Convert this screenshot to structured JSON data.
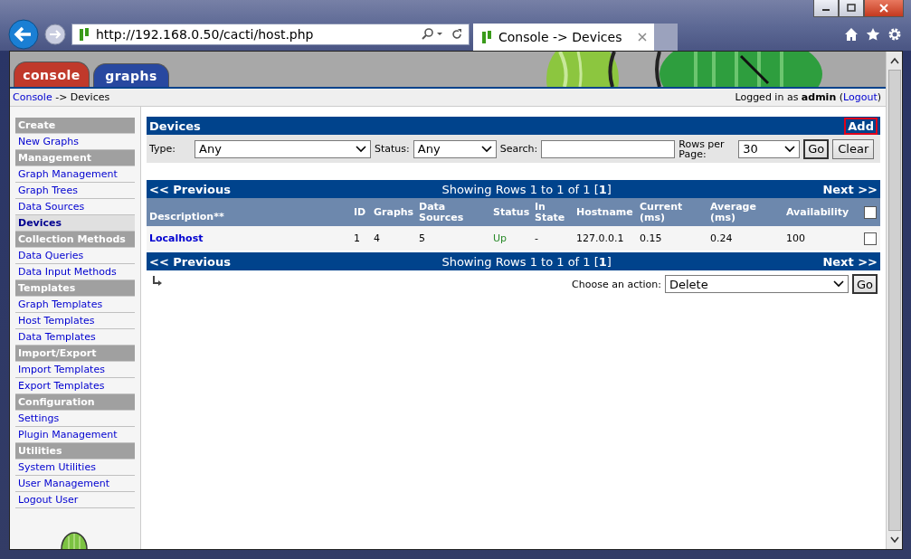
{
  "browser": {
    "address": "http://192.168.0.50/cacti/host.php",
    "tab_title": "Console -> Devices"
  },
  "header": {
    "tabs": [
      {
        "label": "console",
        "selected": true,
        "color": "#c0392b"
      },
      {
        "label": "graphs",
        "selected": false,
        "color": "#2848a0"
      }
    ],
    "breadcrumb_link": "Console",
    "breadcrumb_rest": "-> Devices",
    "login_text": "Logged in as **admin** (",
    "logout_link": "Logout",
    "login_close": ")"
  },
  "sidebar": [
    {
      "title": "Create",
      "items": [
        {
          "label": "New Graphs",
          "selected": false
        }
      ]
    },
    {
      "title": "Management",
      "items": [
        {
          "label": "Graph Management",
          "selected": false
        },
        {
          "label": "Graph Trees",
          "selected": false
        },
        {
          "label": "Data Sources",
          "selected": false
        },
        {
          "label": "Devices",
          "selected": true
        }
      ]
    },
    {
      "title": "Collection Methods",
      "items": [
        {
          "label": "Data Queries",
          "selected": false
        },
        {
          "label": "Data Input Methods",
          "selected": false
        }
      ]
    },
    {
      "title": "Templates",
      "items": [
        {
          "label": "Graph Templates",
          "selected": false
        },
        {
          "label": "Host Templates",
          "selected": false
        },
        {
          "label": "Data Templates",
          "selected": false
        }
      ]
    },
    {
      "title": "Import/Export",
      "items": [
        {
          "label": "Import Templates",
          "selected": false
        },
        {
          "label": "Export Templates",
          "selected": false
        }
      ]
    },
    {
      "title": "Configuration",
      "items": [
        {
          "label": "Settings",
          "selected": false
        },
        {
          "label": "Plugin Management",
          "selected": false
        }
      ]
    },
    {
      "title": "Utilities",
      "items": [
        {
          "label": "System Utilities",
          "selected": false
        },
        {
          "label": "User Management",
          "selected": false
        },
        {
          "label": "Logout User",
          "selected": false
        }
      ]
    }
  ],
  "panel": {
    "title": "Devices",
    "add": "Add",
    "filters": {
      "type_label": "Type:",
      "type_value": "Any",
      "status_label": "Status:",
      "status_value": "Any",
      "search_label": "Search:",
      "rows_label": "Rows per Page:",
      "rows_value": "30",
      "go": "Go",
      "clear": "Clear"
    }
  },
  "nav_top": {
    "previous": "<< Previous",
    "showing": "Showing Rows 1 to 1 of 1 [**1**]",
    "next": "Next >>"
  },
  "table": {
    "columns": [
      "Description**",
      "ID",
      "Graphs",
      "Data Sources",
      "Status",
      "In State",
      "Hostname",
      "Current (ms)",
      "Average (ms)",
      "Availability"
    ],
    "all_checked": false,
    "rows": [
      {
        "cells": [
          "Localhost",
          "1",
          "4",
          "5",
          "Up",
          "-",
          "127.0.0.1",
          "0.15",
          "0.24",
          "100"
        ],
        "checked": false
      }
    ]
  },
  "nav_bottom": {
    "previous": "<< Previous",
    "showing": "Showing Rows 1 to 1 of 1 [**1**]",
    "next": "Next >>"
  },
  "action": {
    "label": "Choose an action:",
    "value": "Delete",
    "go": "Go"
  }
}
